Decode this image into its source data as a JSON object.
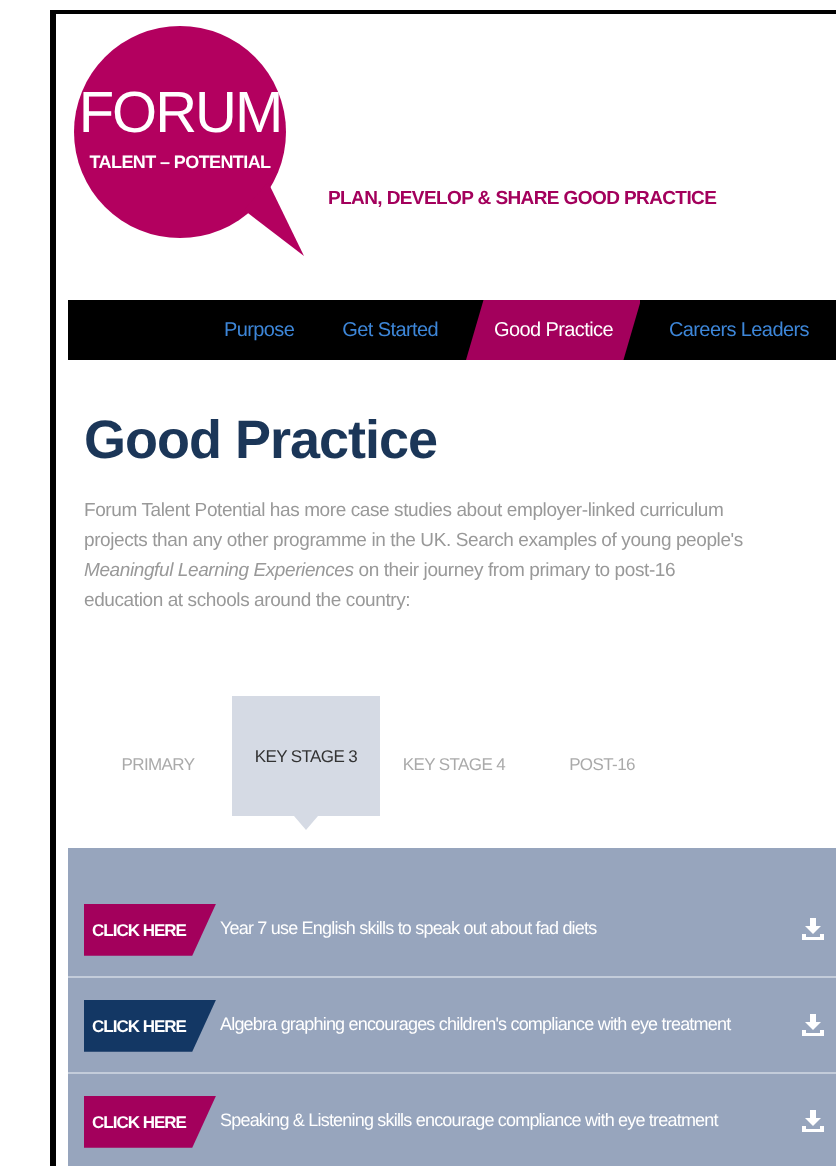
{
  "logo": {
    "title": "FORUM",
    "subtitle": "TALENT – POTENTIAL"
  },
  "tagline": "PLAN, DEVELOP & SHARE GOOD PRACTICE",
  "nav": [
    {
      "label": "Purpose",
      "selected": false
    },
    {
      "label": "Get Started",
      "selected": false
    },
    {
      "label": "Good Practice",
      "selected": true
    },
    {
      "label": "Careers Leaders",
      "selected": false
    }
  ],
  "heading": "Good Practice",
  "intro": "Forum Talent Potential has more case studies about employer-linked curriculum projects than any other programme in the UK. Search examples of young people's *Meaningful Learning Experiences* on their journey from primary to post-16 education at schools around the country:",
  "stage_tabs": [
    {
      "label": "PRIMARY",
      "selected": false
    },
    {
      "label": "KEY STAGE 3",
      "selected": true
    },
    {
      "label": "KEY STAGE 4",
      "selected": false
    },
    {
      "label": "POST-16",
      "selected": false
    }
  ],
  "case_studies": [
    {
      "button": "CLICK HERE",
      "color": "#a3005c",
      "title": "Year 7 use English skills to speak out about fad diets"
    },
    {
      "button": "CLICK HERE",
      "color": "#133764",
      "title": "Algebra graphing encourages children's compliance with eye treatment"
    },
    {
      "button": "CLICK HERE",
      "color": "#a3005c",
      "title": "Speaking & Listening skills encourage compliance with eye treatment"
    }
  ]
}
